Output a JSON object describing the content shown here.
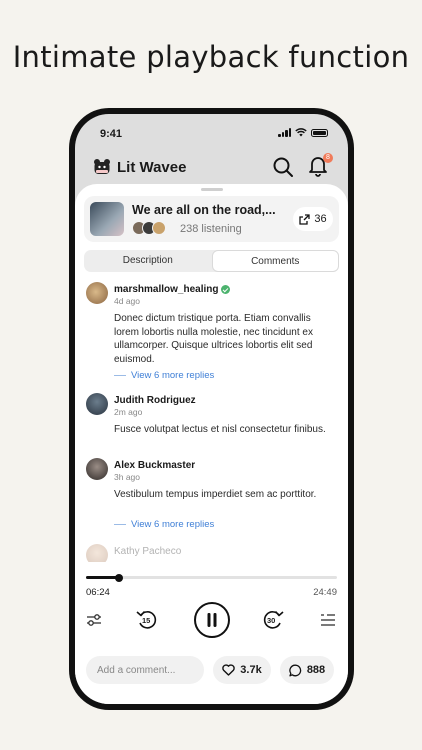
{
  "headline": "Intimate playback function",
  "status_bar": {
    "time": "9:41"
  },
  "app": {
    "name": "Lit Wavee",
    "notification_count": "8"
  },
  "now_playing": {
    "title": "We are all on the road,...",
    "listening": "238 listening",
    "share_count": "36"
  },
  "tabs": [
    {
      "label": "Description",
      "active": false
    },
    {
      "label": "Comments",
      "active": true
    }
  ],
  "comments": [
    {
      "user": "marshmallow_healing",
      "verified": true,
      "time": "4d ago",
      "body": "Donec dictum tristique porta. Etiam convallis lorem lobortis nulla molestie, nec tincidunt ex ullamcorper. Quisque ultrices lobortis elit sed euismod.",
      "replies": "View 6 more replies"
    },
    {
      "user": "Judith Rodriguez",
      "verified": false,
      "time": "2m ago",
      "body": "Fusce volutpat lectus et nisl consectetur finibus.",
      "replies": ""
    },
    {
      "user": "Alex Buckmaster",
      "verified": false,
      "time": "3h ago",
      "body": "Vestibulum tempus imperdiet sem ac porttitor.",
      "replies": "View 6 more replies"
    },
    {
      "user": "Kathy Pacheco",
      "verified": false,
      "time": "",
      "body": "",
      "replies": ""
    }
  ],
  "player": {
    "elapsed": "06:24",
    "total": "24:49",
    "progress_fraction": 0.13,
    "skip_back": "15",
    "skip_forward": "30"
  },
  "bottom": {
    "comment_placeholder": "Add a comment...",
    "likes": "3.7k",
    "comments": "888"
  },
  "colors": {
    "background": "#f5f3ee",
    "accent_link": "#3f7fd6",
    "verified": "#4cb36e",
    "badge": "#f07b5a"
  }
}
